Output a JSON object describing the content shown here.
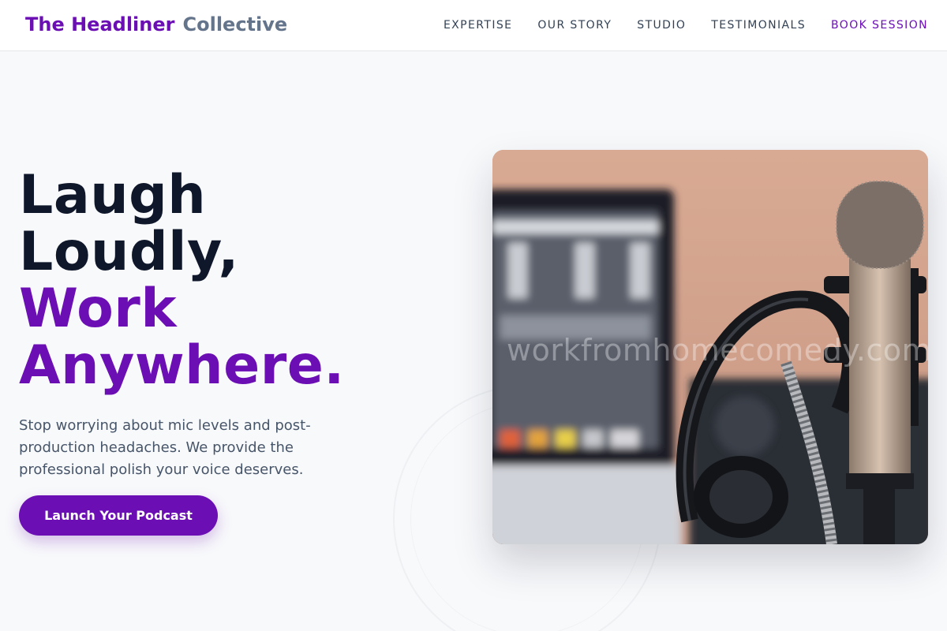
{
  "header": {
    "brand_primary": "The Headliner",
    "brand_secondary": "Collective",
    "nav": [
      "EXPERTISE",
      "OUR STORY",
      "STUDIO",
      "TESTIMONIALS",
      "BOOK SESSION"
    ]
  },
  "hero": {
    "headline_line1": "Laugh",
    "headline_line2": "Loudly,",
    "headline_line3": "Work",
    "headline_line4": "Anywhere.",
    "subtext": "Stop worrying about mic levels and post-production headaches. We provide the professional polish your voice deserves.",
    "cta_label": "Launch Your Podcast",
    "image_watermark": "workfromhomecomedy.com"
  },
  "colors": {
    "accent": "#6b0fb5",
    "heading": "#0f172a",
    "muted": "#64748b",
    "background": "#f8f9fb"
  }
}
